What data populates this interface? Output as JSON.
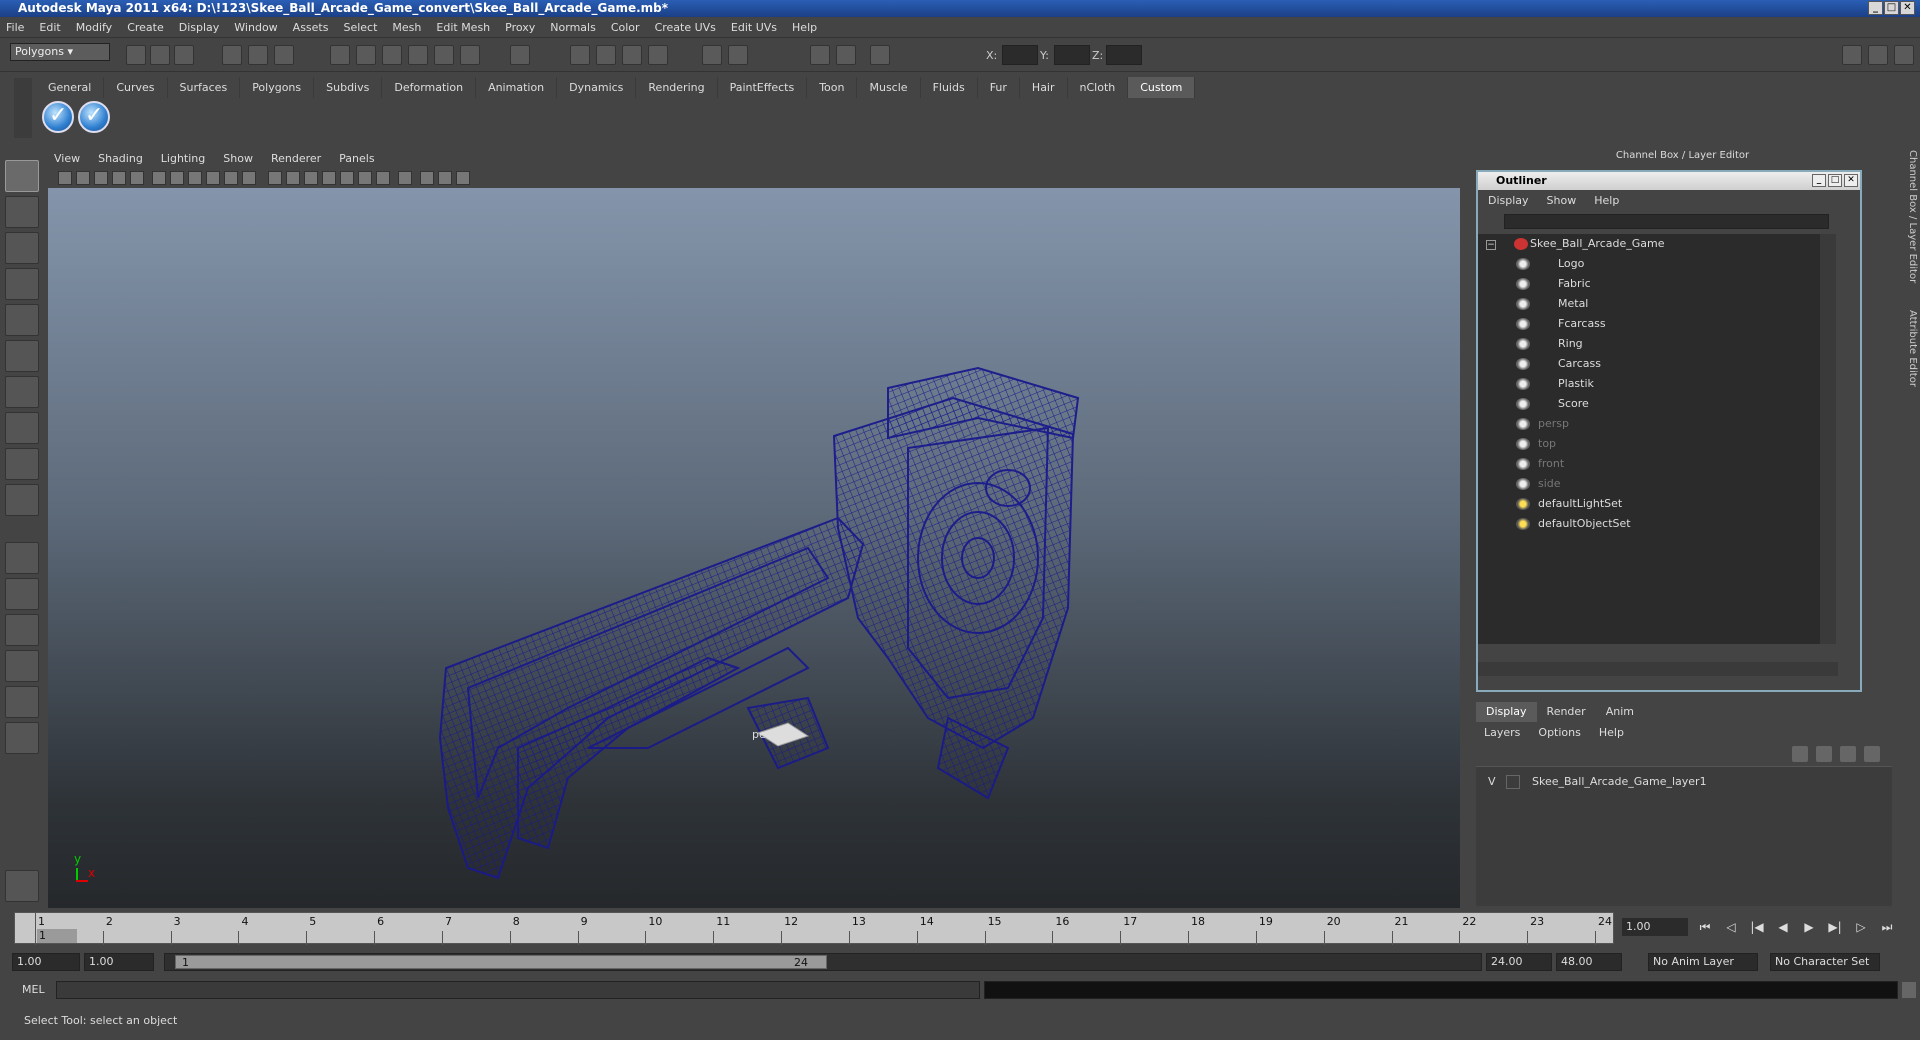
{
  "window": {
    "title": "Autodesk Maya 2011 x64: D:\\!123\\Skee_Ball_Arcade_Game_convert\\Skee_Ball_Arcade_Game.mb*"
  },
  "menubar": [
    "File",
    "Edit",
    "Modify",
    "Create",
    "Display",
    "Window",
    "Assets",
    "Select",
    "Mesh",
    "Edit Mesh",
    "Proxy",
    "Normals",
    "Color",
    "Create UVs",
    "Edit UVs",
    "Help"
  ],
  "statusline": {
    "mode": "Polygons",
    "x_label": "X:",
    "y_label": "Y:",
    "z_label": "Z:"
  },
  "shelf": {
    "tabs": [
      "General",
      "Curves",
      "Surfaces",
      "Polygons",
      "Subdivs",
      "Deformation",
      "Animation",
      "Dynamics",
      "Rendering",
      "PaintEffects",
      "Toon",
      "Muscle",
      "Fluids",
      "Fur",
      "Hair",
      "nCloth",
      "Custom"
    ],
    "active_tab": "Custom"
  },
  "viewport": {
    "menu": [
      "View",
      "Shading",
      "Lighting",
      "Show",
      "Renderer",
      "Panels"
    ],
    "camera_label": "persp",
    "axis_x": "x",
    "axis_y": "y",
    "wire_color": "#1a1a8c"
  },
  "channel_box": {
    "title": "Channel Box / Layer Editor",
    "side_tabs": [
      "Channel Box / Layer Editor",
      "Attribute Editor"
    ]
  },
  "outliner": {
    "title": "Outliner",
    "menu": [
      "Display",
      "Show",
      "Help"
    ],
    "root": "Skee_Ball_Arcade_Game",
    "children": [
      "Logo",
      "Fabric",
      "Metal",
      "Fcarcass",
      "Ring",
      "Carcass",
      "Plastik",
      "Score"
    ],
    "cameras": [
      "persp",
      "top",
      "front",
      "side"
    ],
    "sets": [
      "defaultLightSet",
      "defaultObjectSet"
    ]
  },
  "layer_editor": {
    "tabs": [
      "Display",
      "Render",
      "Anim"
    ],
    "active_tab": "Display",
    "menu": [
      "Layers",
      "Options",
      "Help"
    ],
    "layers": [
      {
        "visible": "V",
        "name": "Skee_Ball_Arcade_Game_layer1"
      }
    ]
  },
  "timeslider": {
    "ticks": [
      "1",
      "2",
      "3",
      "4",
      "5",
      "6",
      "7",
      "8",
      "9",
      "10",
      "11",
      "12",
      "13",
      "14",
      "15",
      "16",
      "17",
      "18",
      "19",
      "20",
      "21",
      "22",
      "23",
      "24"
    ],
    "current_frame_marker": "1",
    "current_time": "1.00"
  },
  "range": {
    "start": "1.00",
    "playback_start": "1.00",
    "slider_start": "1",
    "slider_end": "24",
    "playback_end": "24.00",
    "end": "48.00",
    "anim_layer": "No Anim Layer",
    "character_set": "No Character Set"
  },
  "command": {
    "label": "MEL"
  },
  "help_line": "Select Tool: select an object"
}
